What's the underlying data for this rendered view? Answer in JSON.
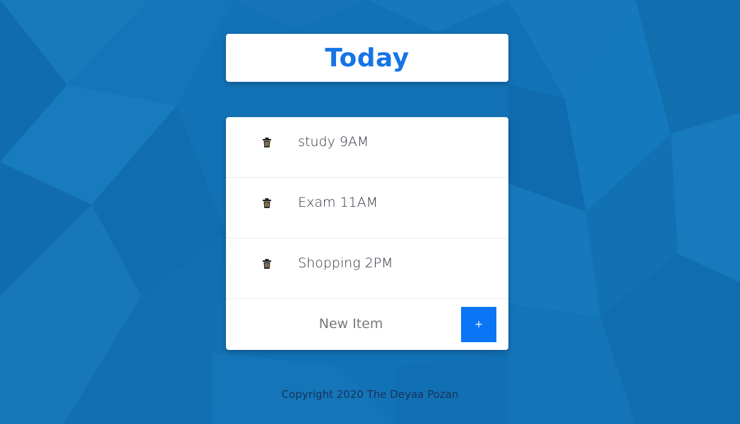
{
  "header": {
    "title": "Today"
  },
  "items": [
    {
      "label": "study 9AM",
      "icon": "trash-icon"
    },
    {
      "label": "Exam 11AM",
      "icon": "trash-icon"
    },
    {
      "label": "Shopping 2PM",
      "icon": "trash-icon"
    }
  ],
  "new_item": {
    "placeholder": "New Item",
    "add_label": "+"
  },
  "footer": {
    "text": "Copyright 2020 The Deyaa Pozan"
  },
  "colors": {
    "background": "#1272b6",
    "title": "#1574e6",
    "add_button": "#0a75f5",
    "footer_text": "#17335a"
  }
}
